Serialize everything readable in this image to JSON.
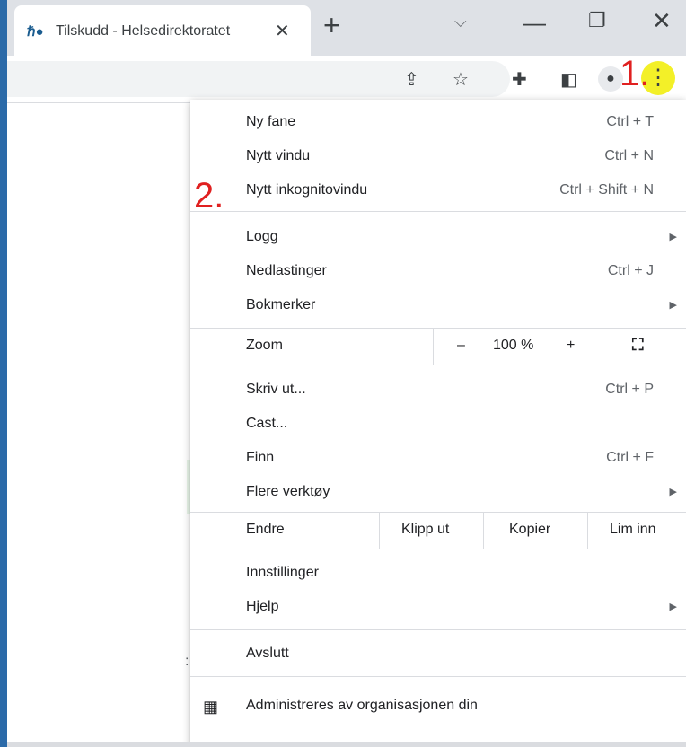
{
  "tab": {
    "favicon": "helsedirektoratet-logo-icon",
    "title": "Tilskudd - Helsedirektoratet",
    "close_icon": "close-icon"
  },
  "tabstrip": {
    "new_tab_symbol": "+",
    "search_tabs_symbol": "⌵",
    "minimize_symbol": "—",
    "maximize_symbol": "❐",
    "close_symbol": "✕"
  },
  "toolbar": {
    "icons": [
      "share-icon",
      "star-icon",
      "extensions-icon",
      "side-panel-icon",
      "profile-avatar-icon",
      "more-menu-icon"
    ],
    "share_symbol": "⇪",
    "star_symbol": "☆",
    "ext_symbol": "✚",
    "side_symbol": "◧",
    "avatar_symbol": "●",
    "menu_symbol": "⋮"
  },
  "annotations": {
    "step1": "1.",
    "step2": "2.",
    "highlight_color": "#f5f23a",
    "annotation_color": "#e02020"
  },
  "menu": {
    "new_tab": {
      "label": "Ny fane",
      "shortcut": "Ctrl + T"
    },
    "new_window": {
      "label": "Nytt vindu",
      "shortcut": "Ctrl + N"
    },
    "incognito": {
      "label": "Nytt inkognitovindu",
      "shortcut": "Ctrl + Shift + N"
    },
    "history": {
      "label": "Logg"
    },
    "downloads": {
      "label": "Nedlastinger",
      "shortcut": "Ctrl + J"
    },
    "bookmarks": {
      "label": "Bokmerker"
    },
    "zoom": {
      "label": "Zoom",
      "minus": "–",
      "value": "100 %",
      "plus": "+",
      "fullscreen_icon": "fullscreen-icon"
    },
    "print": {
      "label": "Skriv ut...",
      "shortcut": "Ctrl + P"
    },
    "cast": {
      "label": "Cast..."
    },
    "find": {
      "label": "Finn",
      "shortcut": "Ctrl + F"
    },
    "more_tools": {
      "label": "Flere verktøy"
    },
    "edit": {
      "label": "Endre",
      "cut": "Klipp ut",
      "copy": "Kopier",
      "paste": "Lim inn"
    },
    "settings": {
      "label": "Innstillinger"
    },
    "help": {
      "label": "Hjelp"
    },
    "exit": {
      "label": "Avslutt"
    },
    "managed": {
      "label": "Administreres av organisasjonen din",
      "icon": "building-icon"
    }
  },
  "background": {
    "fragment": ":"
  }
}
